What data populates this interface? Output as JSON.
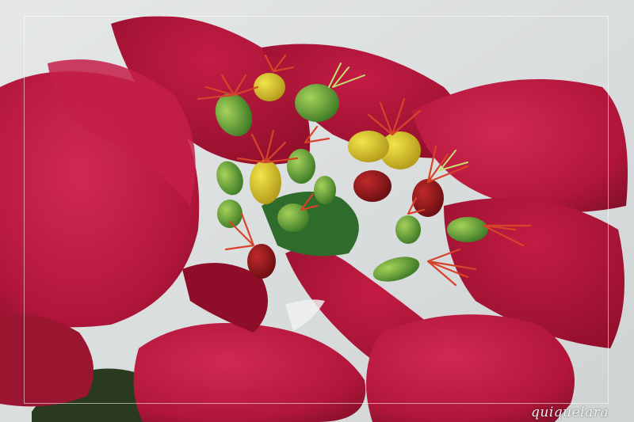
{
  "photo": {
    "subject_icon": "poinsettia-flower",
    "palette": {
      "petal": "#b8173c",
      "petal_dark": "#7e0a24",
      "petal_light": "#d4345a",
      "background": "#dcdfe0",
      "bud_green": "#5f9a3a",
      "bud_yellow": "#d8c52a",
      "stamen": "#d13a25"
    }
  },
  "watermark": "quiquelara"
}
